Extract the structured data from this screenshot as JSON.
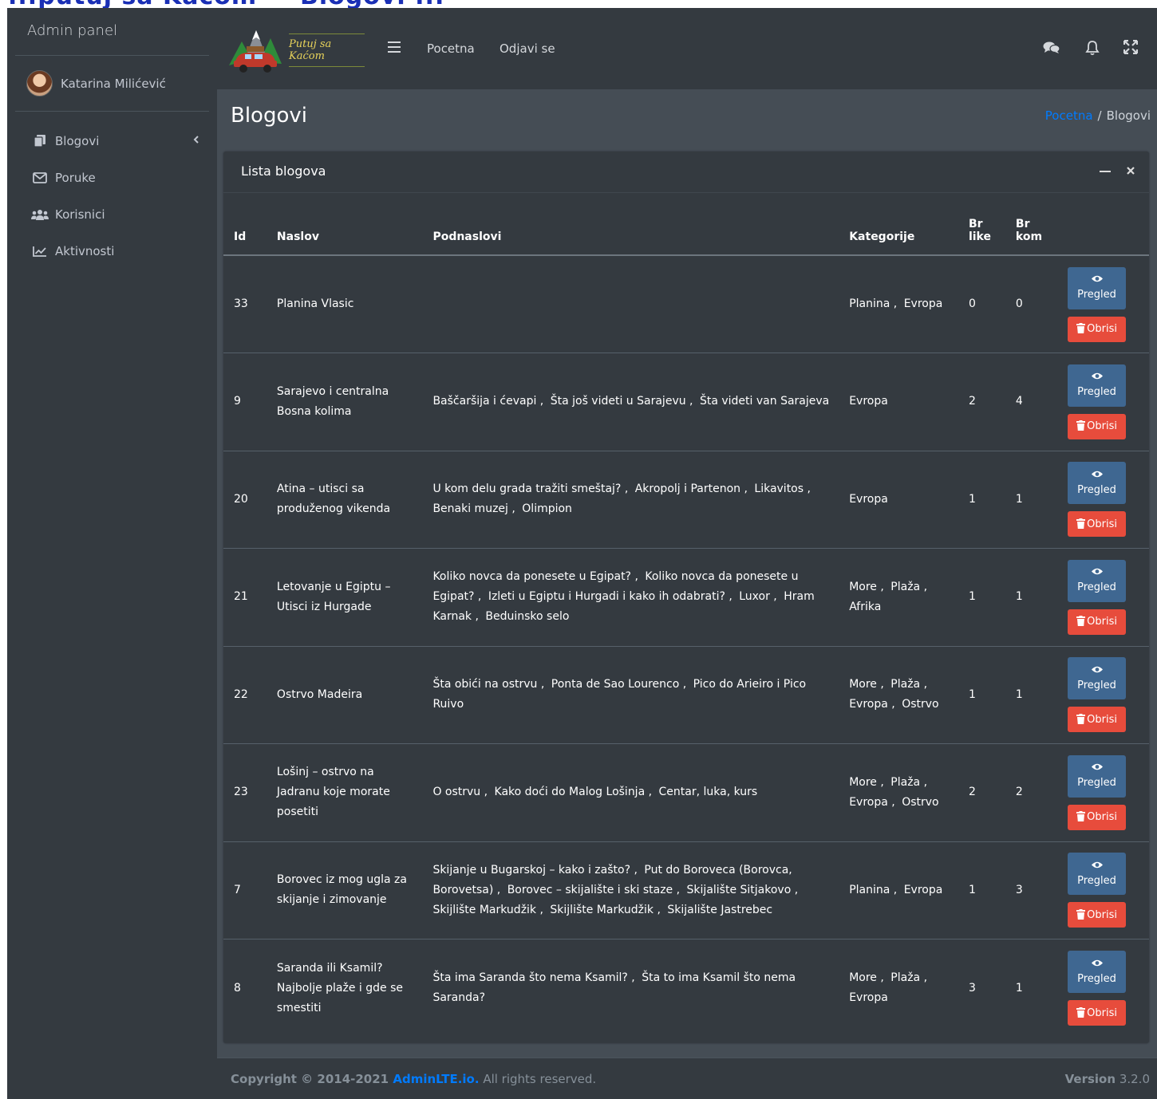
{
  "header_banner": "...putuj sa Kacom — Blogovi ...",
  "sidebar": {
    "brand": "Admin panel",
    "user_name": "Katarina Milićević",
    "items": [
      {
        "label": "Blogovi",
        "icon": "copy-icon"
      },
      {
        "label": "Poruke",
        "icon": "envelope-icon"
      },
      {
        "label": "Korisnici",
        "icon": "users-icon"
      },
      {
        "label": "Aktivnosti",
        "icon": "chart-line-icon"
      }
    ]
  },
  "navbar": {
    "logo_text": "Putuj sa Kaćom",
    "links": [
      "Pocetna",
      "Odjavi se"
    ]
  },
  "page": {
    "title": "Blogovi",
    "breadcrumb_home": "Pocetna",
    "breadcrumb_sep": "/",
    "breadcrumb_current": "Blogovi"
  },
  "card": {
    "title": "Lista blogova",
    "columns": [
      "Id",
      "Naslov",
      "Podnaslovi",
      "Kategorije",
      "Br like",
      "Br kom"
    ],
    "view_label": "Pregled",
    "delete_label": "Obrisi",
    "rows": [
      {
        "id": "33",
        "title": "Planina Vlasic",
        "subtitles": [],
        "categories": [
          "Planina",
          "Evropa"
        ],
        "likes": "0",
        "comments": "0"
      },
      {
        "id": "9",
        "title": "Sarajevo i centralna Bosna kolima",
        "subtitles": [
          "Baščaršija i ćevapi",
          "Šta još videti u Sarajevu",
          "Šta videti van Sarajeva"
        ],
        "categories": [
          "Evropa"
        ],
        "likes": "2",
        "comments": "4"
      },
      {
        "id": "20",
        "title": "Atina – utisci sa produženog vikenda",
        "subtitles": [
          "U kom delu grada tražiti smeštaj?",
          "Akropolj i Partenon",
          "Likavitos",
          "Benaki muzej",
          "Olimpion"
        ],
        "categories": [
          "Evropa"
        ],
        "likes": "1",
        "comments": "1"
      },
      {
        "id": "21",
        "title": "Letovanje u Egiptu – Utisci iz Hurgade",
        "subtitles": [
          "Koliko novca da ponesete u Egipat?",
          "Koliko novca da ponesete u Egipat?",
          "Izleti u Egiptu i Hurgadi i kako ih odabrati?",
          "Luxor",
          "Hram Karnak",
          "Beduinsko selo"
        ],
        "categories": [
          "More",
          "Plaža",
          "Afrika"
        ],
        "likes": "1",
        "comments": "1"
      },
      {
        "id": "22",
        "title": "Ostrvo Madeira",
        "subtitles": [
          "Šta obići na ostrvu",
          "Ponta de Sao Lourenco",
          "Pico do Arieiro i Pico Ruivo"
        ],
        "categories": [
          "More",
          "Plaža",
          "Evropa",
          "Ostrvo"
        ],
        "likes": "1",
        "comments": "1"
      },
      {
        "id": "23",
        "title": "Lošinj – ostrvo na Jadranu koje morate posetiti",
        "subtitles": [
          "O ostrvu",
          "Kako doći do Malog Lošinja",
          "Centar, luka, kurs"
        ],
        "categories": [
          "More",
          "Plaža",
          "Evropa",
          "Ostrvo"
        ],
        "likes": "2",
        "comments": "2"
      },
      {
        "id": "7",
        "title": "Borovec iz mog ugla za skijanje i zimovanje",
        "subtitles": [
          "Skijanje u Bugarskoj – kako i zašto?",
          "Put do Boroveca (Borovca, Borovetsa)",
          "Borovec – skijalište i ski staze",
          "Skijalište Sitjakovo",
          "Skijlište Markudžik",
          "Skijlište Markudžik",
          "Skijalište Jastrebec"
        ],
        "categories": [
          "Planina",
          "Evropa"
        ],
        "likes": "1",
        "comments": "3"
      },
      {
        "id": "8",
        "title": "Saranda ili Ksamil? Najbolje plaže i gde se smestiti",
        "subtitles": [
          "Šta ima Saranda što nema Ksamil?",
          "Šta to ima Ksamil što nema Saranda?"
        ],
        "categories": [
          "More",
          "Plaža",
          "Evropa"
        ],
        "likes": "3",
        "comments": "1"
      }
    ]
  },
  "footer": {
    "copyright_prefix": "Copyright © 2014-2021 ",
    "copyright_link": "AdminLTE.io.",
    "copyright_suffix": " All rights reserved.",
    "version_label": "Version",
    "version_value": "3.2.0"
  },
  "colors": {
    "primary_link": "#007bff",
    "view_button": "#3f6791",
    "delete_button": "#e74c3c"
  }
}
